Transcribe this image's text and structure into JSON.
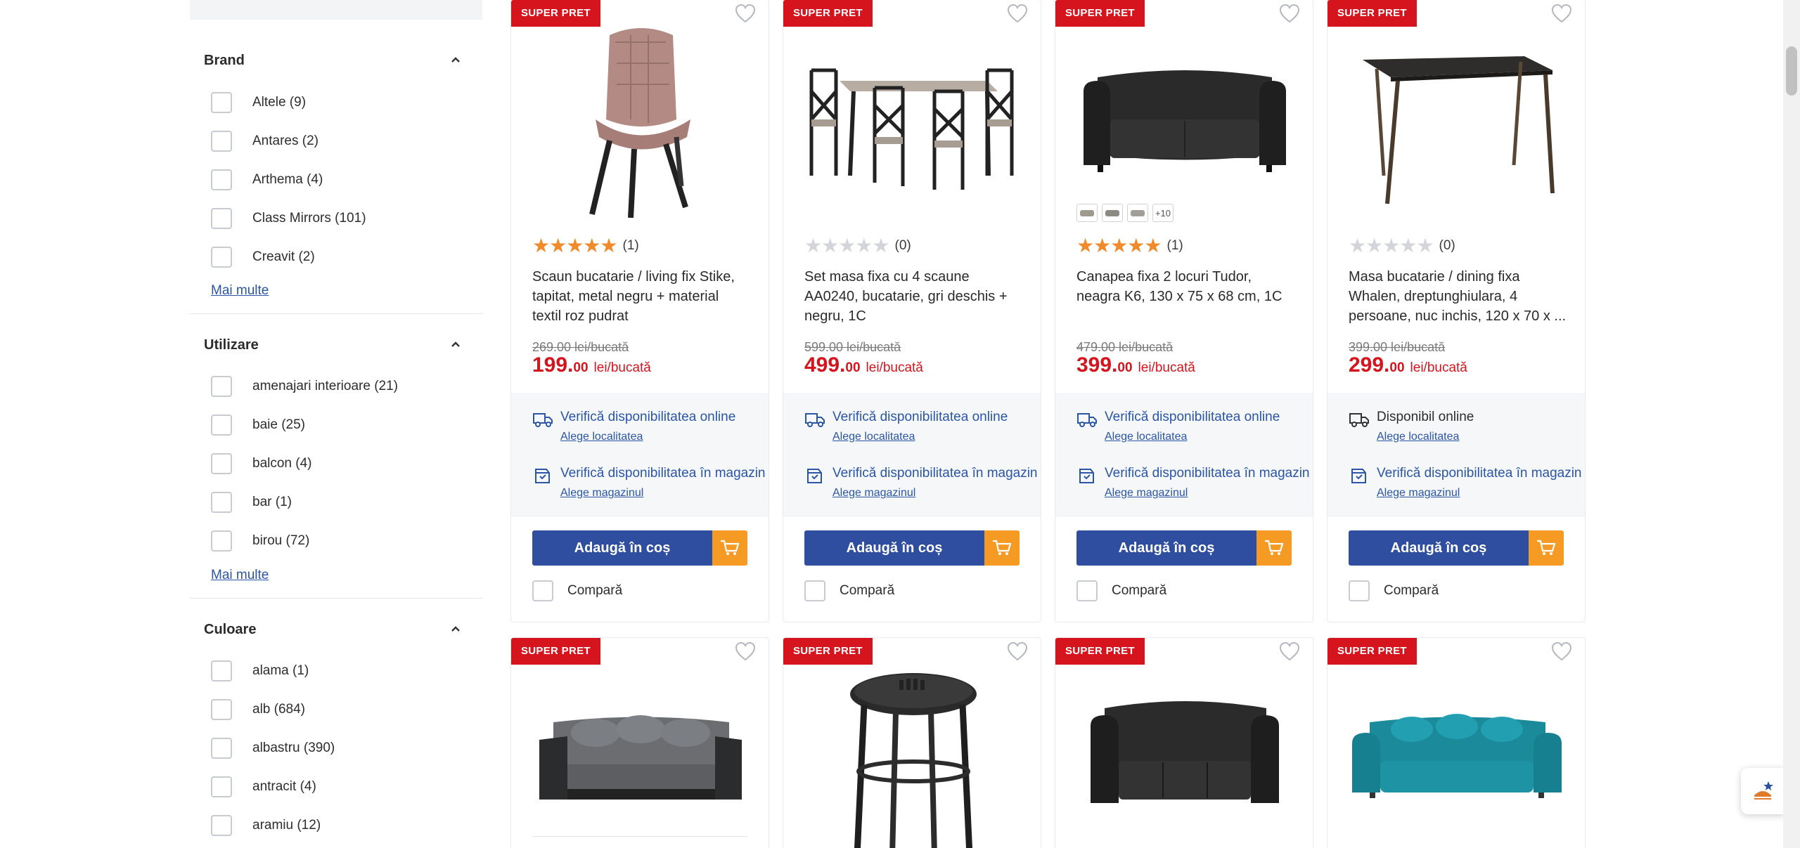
{
  "sidebar": {
    "facets": [
      {
        "title": "Brand",
        "options": [
          "Altele (9)",
          "Antares (2)",
          "Arthema (4)",
          "Class Mirrors (101)",
          "Creavit (2)"
        ],
        "more": "Mai multe"
      },
      {
        "title": "Utilizare",
        "options": [
          "amenajari interioare (21)",
          "baie (25)",
          "balcon (4)",
          "bar (1)",
          "birou (72)"
        ],
        "more": "Mai multe"
      },
      {
        "title": "Culoare",
        "options": [
          "alama (1)",
          "alb (684)",
          "albastru (390)",
          "antracit (4)",
          "aramiu (12)"
        ],
        "more": ""
      }
    ]
  },
  "products": [
    {
      "badge": "SUPER PRET",
      "image": "pink-velvet-chair",
      "rating": 5,
      "rating_count": "(1)",
      "title": "Scaun bucatarie / living fix Stike, tapitat, metal negru + material textil roz pudrat",
      "old_price": "269.00 lei/bucată",
      "price_int": "199.",
      "price_dec": "00",
      "price_unit": "lei/bucată",
      "avail_online": "Verifică disponibilitatea online",
      "avail_online_link": "Alege localitatea",
      "avail_store": "Verifică disponibilitatea în magazin",
      "avail_store_link": "Alege magazinul",
      "cart_label": "Adaugă în coș",
      "compare_label": "Compară"
    },
    {
      "badge": "SUPER PRET",
      "image": "dining-set-table-4-chairs",
      "rating": 0,
      "rating_count": "(0)",
      "title": "Set masa fixa cu 4 scaune AA0240, bucatarie, gri deschis + negru, 1C",
      "old_price": "599.00 lei/bucată",
      "price_int": "499.",
      "price_dec": "00",
      "price_unit": "lei/bucată",
      "avail_online": "Verifică disponibilitatea online",
      "avail_online_link": "Alege localitatea",
      "avail_store": "Verifică disponibilitatea în magazin",
      "avail_store_link": "Alege magazinul",
      "cart_label": "Adaugă în coș",
      "compare_label": "Compară"
    },
    {
      "badge": "SUPER PRET",
      "image": "black-two-seat-sofa",
      "rating": 5,
      "rating_count": "(1)",
      "swatches_more": "+10",
      "title": "Canapea fixa 2 locuri Tudor, neagra K6, 130 x 75 x 68 cm, 1C",
      "old_price": "479.00 lei/bucată",
      "price_int": "399.",
      "price_dec": "00",
      "price_unit": "lei/bucată",
      "avail_online": "Verifică disponibilitatea online",
      "avail_online_link": "Alege localitatea",
      "avail_store": "Verifică disponibilitatea în magazin",
      "avail_store_link": "Alege magazinul",
      "cart_label": "Adaugă în coș",
      "compare_label": "Compară"
    },
    {
      "badge": "SUPER PRET",
      "image": "dark-dining-table",
      "rating": 0,
      "rating_count": "(0)",
      "title": "Masa bucatarie / dining fixa Whalen, dreptunghiulara, 4 persoane, nuc inchis, 120 x 70 x ...",
      "old_price": "399.00 lei/bucată",
      "price_int": "299.",
      "price_dec": "00",
      "price_unit": "lei/bucată",
      "avail_online": "Disponibil online",
      "avail_online_link": "Alege localitatea",
      "avail_store": "Verifică disponibilitatea în magazin",
      "avail_store_link": "Alege magazinul",
      "cart_label": "Adaugă în coș",
      "compare_label": "Compară"
    }
  ],
  "products_row2": [
    {
      "badge": "SUPER PRET",
      "image": "grey-sofa-bed"
    },
    {
      "badge": "SUPER PRET",
      "image": "black-metal-stool"
    },
    {
      "badge": "SUPER PRET",
      "image": "black-leather-sofa"
    },
    {
      "badge": "SUPER PRET",
      "image": "teal-sofa"
    }
  ],
  "colors": {
    "badge": "#d6141e",
    "price": "#d6141e",
    "cart": "#2f4ea0",
    "cart_icon": "#f59a23",
    "star": "#f08a2a",
    "link": "#2a55a8"
  }
}
